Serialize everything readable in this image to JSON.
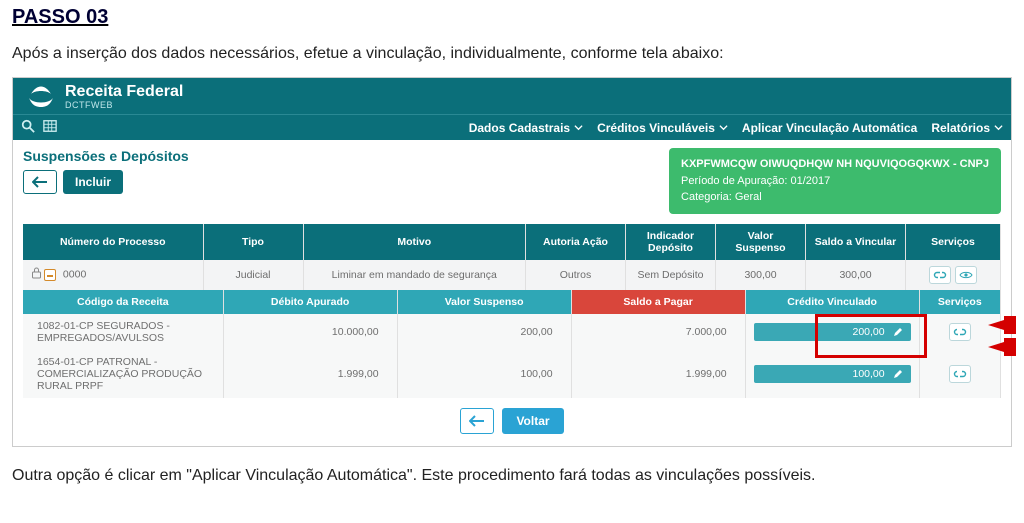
{
  "doc": {
    "step_title": "PASSO 03",
    "lead": "Após a inserção dos dados necessários, efetue a vinculação, individualmente, conforme tela abaixo:",
    "footer": "Outra opção é clicar em \"Aplicar Vinculação Automática\". Este procedimento fará todas as vinculações possíveis."
  },
  "brand": {
    "name": "Receita Federal",
    "product": "DCTFWEB"
  },
  "menu": {
    "items": [
      "Dados Cadastrais",
      "Créditos Vinculáveis",
      "Aplicar Vinculação Automática",
      "Relatórios"
    ],
    "has_dropdown": [
      true,
      true,
      false,
      true
    ]
  },
  "section_title": "Suspensões e Depósitos",
  "buttons": {
    "incluir": "Incluir",
    "voltar": "Voltar"
  },
  "infobox": {
    "line1": "KXPFWMCQW OIWUQDHQW NH NQUVIQOGQKWX - CNPJ",
    "line2": "Período de Apuração: 01/2017",
    "line3": "Categoria: Geral"
  },
  "grid": {
    "headers": [
      "Número do Processo",
      "Tipo",
      "Motivo",
      "Autoria Ação",
      "Indicador Depósito",
      "Valor Suspenso",
      "Saldo a Vincular",
      "Serviços"
    ],
    "row": {
      "processo": "0000",
      "tipo": "Judicial",
      "motivo": "Liminar em mandado de segurança",
      "autoria": "Outros",
      "indicador": "Sem Depósito",
      "valor_suspenso": "300,00",
      "saldo_vincular": "300,00"
    }
  },
  "sub": {
    "headers": [
      "Código da Receita",
      "Débito Apurado",
      "Valor Suspenso",
      "Saldo a Pagar",
      "Crédito Vinculado",
      "Serviços"
    ],
    "rows": [
      {
        "codigo": "1082-01-CP SEGURADOS - EMPREGADOS/AVULSOS",
        "debito": "10.000,00",
        "suspenso": "200,00",
        "saldo_pagar": "7.000,00",
        "credito": "200,00"
      },
      {
        "codigo": "1654-01-CP PATRONAL - COMERCIALIZAÇÃO PRODUÇÃO RURAL PRPF",
        "debito": "1.999,00",
        "suspenso": "100,00",
        "saldo_pagar": "1.999,00",
        "credito": "100,00"
      }
    ]
  },
  "icons": {
    "search": "search-icon",
    "table": "table-icon",
    "lock": "lock-icon",
    "link": "link-icon",
    "eye": "eye-icon",
    "pencil": "pencil-icon",
    "back_arrow": "back-arrow-icon",
    "left_arrow_btn": "left-arrow-icon"
  }
}
